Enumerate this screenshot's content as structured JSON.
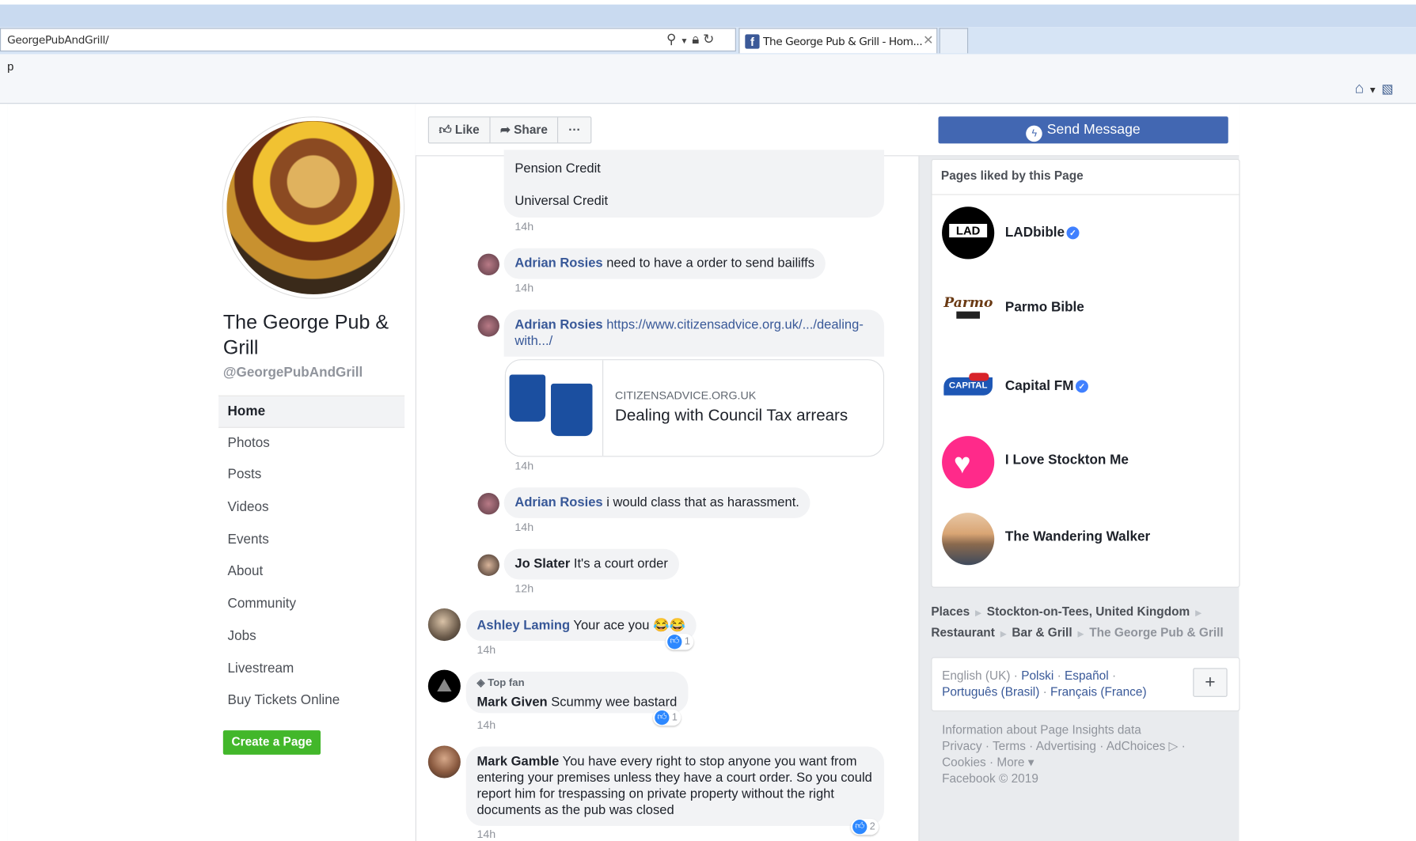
{
  "browser": {
    "address": "GeorgePubAndGrill/",
    "tab_title": "The George Pub & Grill - Hom...",
    "tab_favicon": "f",
    "toolbar_letter": "p"
  },
  "page": {
    "name": "The George Pub & Grill",
    "handle": "@GeorgePubAndGrill",
    "nav": [
      "Home",
      "Photos",
      "Posts",
      "Videos",
      "Events",
      "About",
      "Community",
      "Jobs",
      "Livestream",
      "Buy Tickets Online"
    ],
    "create_page": "Create a Page"
  },
  "actions": {
    "like": "Like",
    "share": "Share",
    "more": "···",
    "send_message": "Send Message"
  },
  "comments": {
    "c0": {
      "line1": "Pension Credit",
      "line2": "Universal Credit",
      "time": "14h"
    },
    "c1": {
      "name": "Adrian Rosies",
      "text": " need to have a order to send bailiffs",
      "time": "14h"
    },
    "c2": {
      "name": "Adrian Rosies",
      "link": "https://www.citizensadvice.org.uk/.../dealing-with.../",
      "time": "14h"
    },
    "card": {
      "domain": "CITIZENSADVICE.ORG.UK",
      "title": "Dealing with Council Tax arrears"
    },
    "c3": {
      "name": "Adrian Rosies",
      "text": " i would class that as harassment.",
      "time": "14h"
    },
    "c4": {
      "name": "Jo Slater",
      "text": " It's a court order",
      "time": "12h"
    },
    "c5": {
      "name": "Ashley Laming",
      "text": " Your ace you 😂😂",
      "time": "14h",
      "likes": "1"
    },
    "c6": {
      "badge": "Top fan",
      "name": "Mark Given",
      "text": " Scummy wee bastard",
      "time": "14h",
      "likes": "1"
    },
    "c7": {
      "name": "Mark Gamble",
      "text": " You have every right to stop anyone you want from entering your premises unless they have a court order. So you could report him for trespassing on private property without the right documents as the pub was closed",
      "time": "14h",
      "likes": "2"
    }
  },
  "liked": {
    "title": "Pages liked by this Page",
    "pages": [
      {
        "name": "LADbible",
        "verified": true,
        "logo": "LAD"
      },
      {
        "name": "Parmo Bible",
        "verified": false,
        "logo": "Parmo"
      },
      {
        "name": "Capital FM",
        "verified": true,
        "logo": "CAPITAL"
      },
      {
        "name": "I Love Stockton Me",
        "verified": false,
        "logo": ""
      },
      {
        "name": "The Wandering Walker",
        "verified": false,
        "logo": ""
      }
    ]
  },
  "breadcrumbs": {
    "places": "Places",
    "location": "Stockton-on-Tees, United Kingdom",
    "restaurant": "Restaurant",
    "bar": "Bar & Grill",
    "current": "The George Pub & Grill"
  },
  "languages": {
    "current": "English (UK)",
    "others": [
      "Polski",
      "Español",
      "Português (Brasil)",
      "Français (France)"
    ],
    "plus": "+"
  },
  "footer": {
    "insights": "Information about Page Insights data",
    "links": "Privacy · Terms · Advertising · AdChoices ▷ ·",
    "links2": "Cookies · More ▾",
    "copyright": "Facebook © 2019"
  },
  "colors": {
    "fb_blue": "#4267b2",
    "link": "#385898",
    "green": "#42b72a"
  }
}
